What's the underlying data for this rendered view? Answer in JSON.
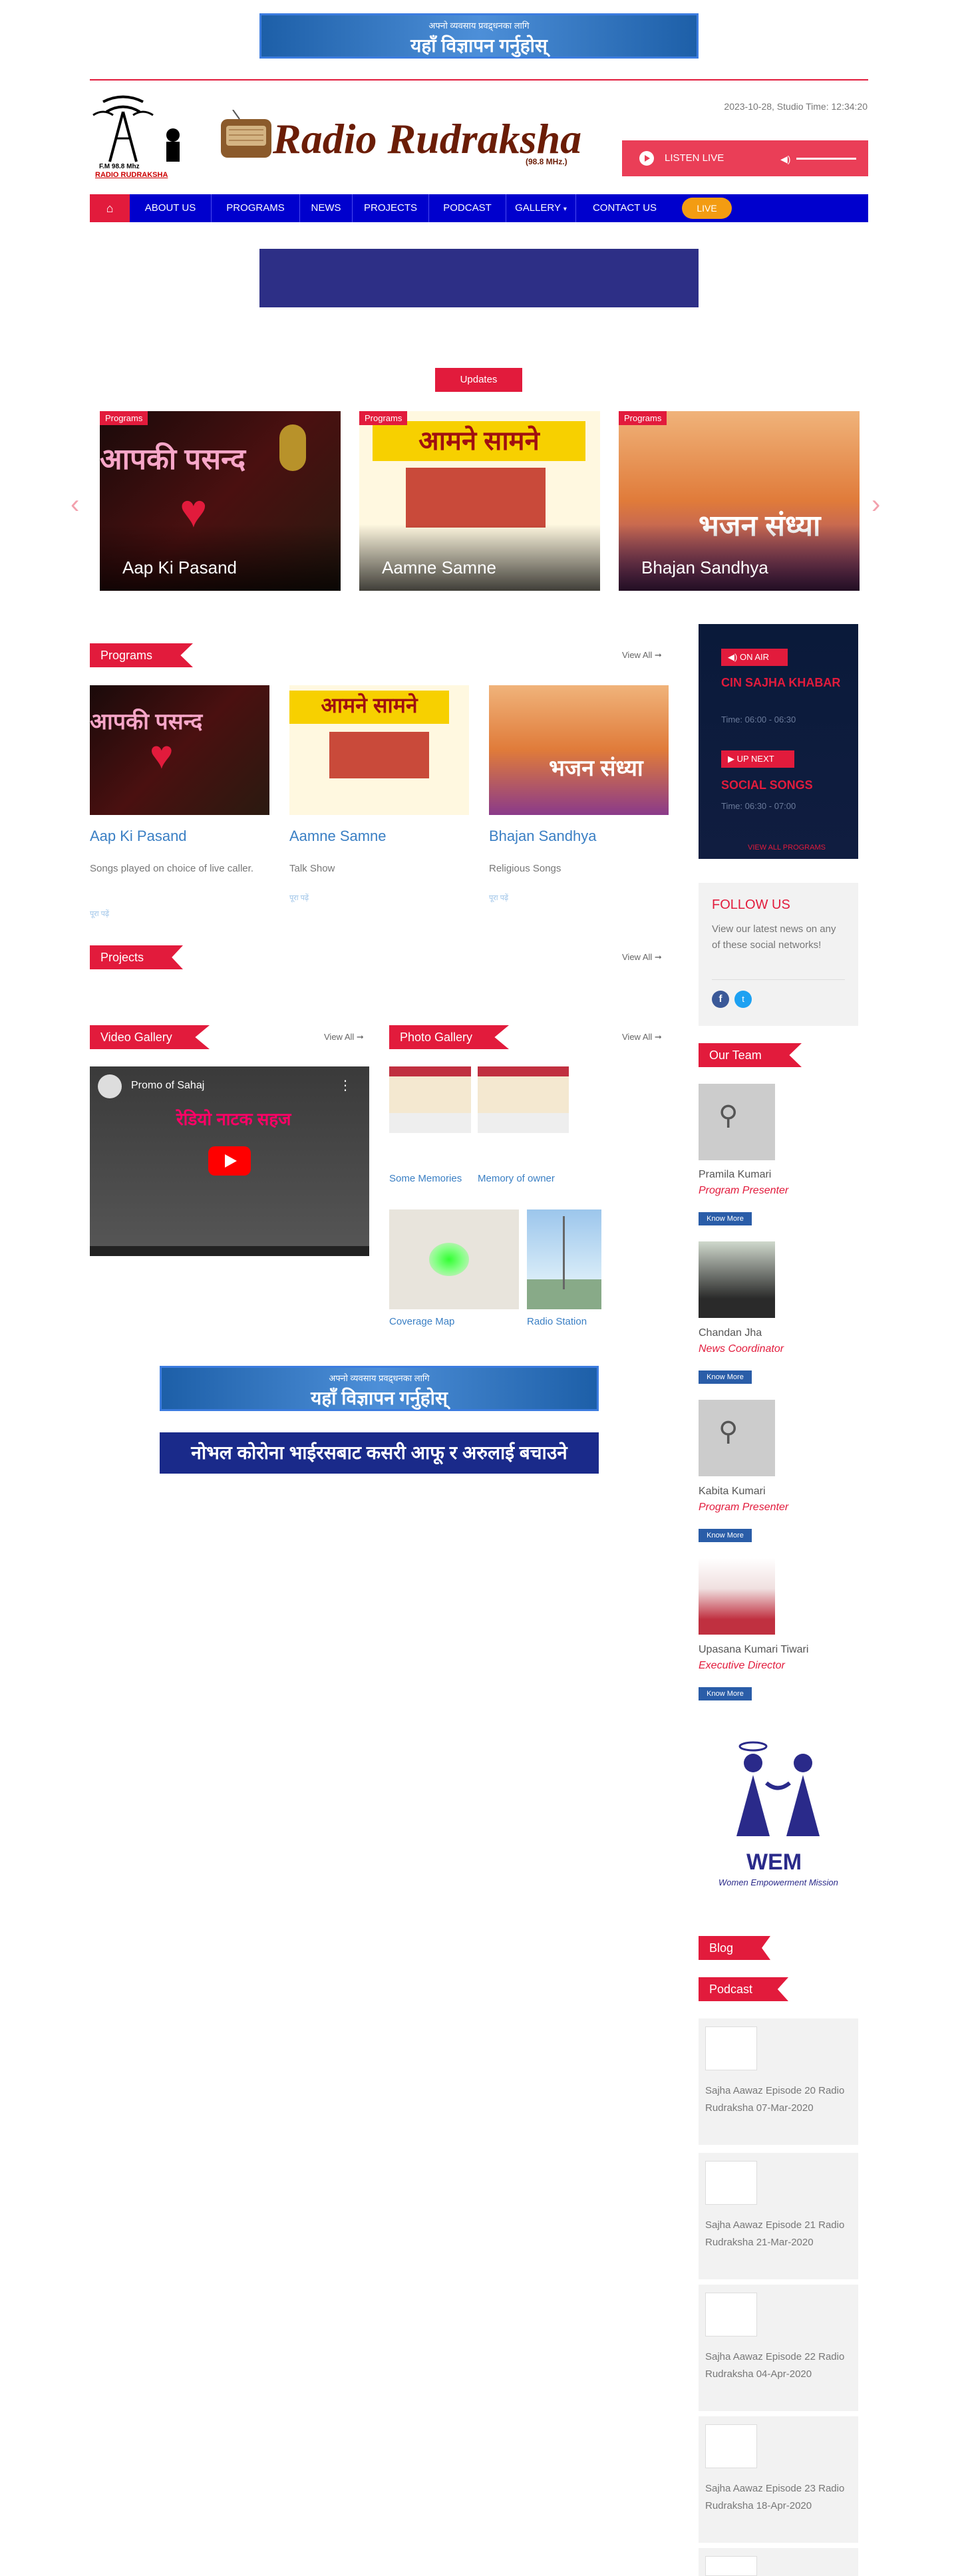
{
  "header": {
    "top_ad_line1": "अफ्नो व्यवसाय प्रवद्र्धनका लागि",
    "top_ad_line2": "यहाँ विज्ञापन गर्नुहोस्",
    "logo_text_freq": "F.M 98.8 Mhz",
    "logo_text_name": "RADIO RUDRAKSHA",
    "brand_name": "Radio Rudraksha",
    "brand_mhz": "(98.8 MHz.)",
    "datetime": "2023-10-28, Studio Time: 12:34:20",
    "listen_label": "LISTEN LIVE"
  },
  "nav": {
    "items": [
      "ABOUT US",
      "PROGRAMS",
      "NEWS",
      "PROJECTS",
      "PODCAST",
      "GALLERY",
      "CONTACT US"
    ],
    "live": "LIVE"
  },
  "updates_label": "Updates",
  "slider": [
    {
      "tag": "Programs",
      "title": "Aap Ki Pasand",
      "banner": "आपकी पसन्द"
    },
    {
      "tag": "Programs",
      "title": "Aamne Samne",
      "banner": "आमने सामने"
    },
    {
      "tag": "Programs",
      "title": "Bhajan Sandhya",
      "banner": "भजन संध्या"
    }
  ],
  "programs_section": {
    "heading": "Programs",
    "view_all": "View All ➞",
    "items": [
      {
        "title": "Aap Ki Pasand",
        "desc": "Songs played on choice of live caller.",
        "link": "पूरा पढ़ें",
        "banner": "आपकी पसन्द"
      },
      {
        "title": "Aamne Samne",
        "desc": "Talk Show",
        "link": "पूरा पढ़ें",
        "banner": "आमने सामने"
      },
      {
        "title": "Bhajan Sandhya",
        "desc": "Religious Songs",
        "link": "पूरा पढ़ें",
        "banner": "भजन संध्या"
      }
    ]
  },
  "projects_section": {
    "heading": "Projects",
    "view_all": "View All ➞"
  },
  "video_gallery": {
    "heading": "Video Gallery",
    "view_all": "View All ➞",
    "video_title": "Promo of Sahaj",
    "video_overlay": "रेडियो नाटक सहज"
  },
  "photo_gallery": {
    "heading": "Photo Gallery",
    "view_all": "View All ➞",
    "items": [
      "Some Memories",
      "Memory of owner",
      "Coverage Map",
      "Radio Station"
    ]
  },
  "bottom_ad": {
    "line1": "अफ्नो व्यवसाय प्रवद्र्धनका लागि",
    "line2": "यहाँ विज्ञापन गर्नुहोस्"
  },
  "corona_banner": "नोभल कोरोना भाईरसबाट कसरी आफू र अरुलाई बचाउने",
  "onair": {
    "on_air_label": "ON AIR",
    "on_air_title": "CIN SAJHA KHABAR",
    "on_air_time": "Time: 06:00 - 06:30",
    "up_next_label": "UP NEXT",
    "up_next_title": "SOCIAL SONGS",
    "up_next_time": "Time: 06:30 - 07:00",
    "view_all": "VIEW ALL PROGRAMS"
  },
  "follow": {
    "heading": "FOLLOW US",
    "text": "View our latest news on any of these social networks!"
  },
  "team": {
    "heading": "Our Team",
    "know_label": "Know More",
    "members": [
      {
        "name": "Pramila Kumari",
        "role": "Program Presenter"
      },
      {
        "name": "Chandan Jha",
        "role": "News Coordinator"
      },
      {
        "name": "Kabita Kumari",
        "role": "Program Presenter"
      },
      {
        "name": "Upasana Kumari Tiwari",
        "role": "Executive Director"
      }
    ]
  },
  "wem": {
    "name": "WEM",
    "sub": "Women Empowerment Mission"
  },
  "blog_heading": "Blog",
  "podcast": {
    "heading": "Podcast",
    "items": [
      "Sajha Aawaz Episode 20 Radio Rudraksha 07-Mar-2020",
      "Sajha Aawaz Episode 21 Radio Rudraksha 21-Mar-2020",
      "Sajha Aawaz Episode 22 Radio Rudraksha 04-Apr-2020",
      "Sajha Aawaz Episode 23 Radio Rudraksha 18-Apr-2020"
    ]
  },
  "colors": {
    "accent": "#e21b3c",
    "nav": "#0000cd",
    "live": "#f39c12",
    "link": "#3a7fc4"
  }
}
